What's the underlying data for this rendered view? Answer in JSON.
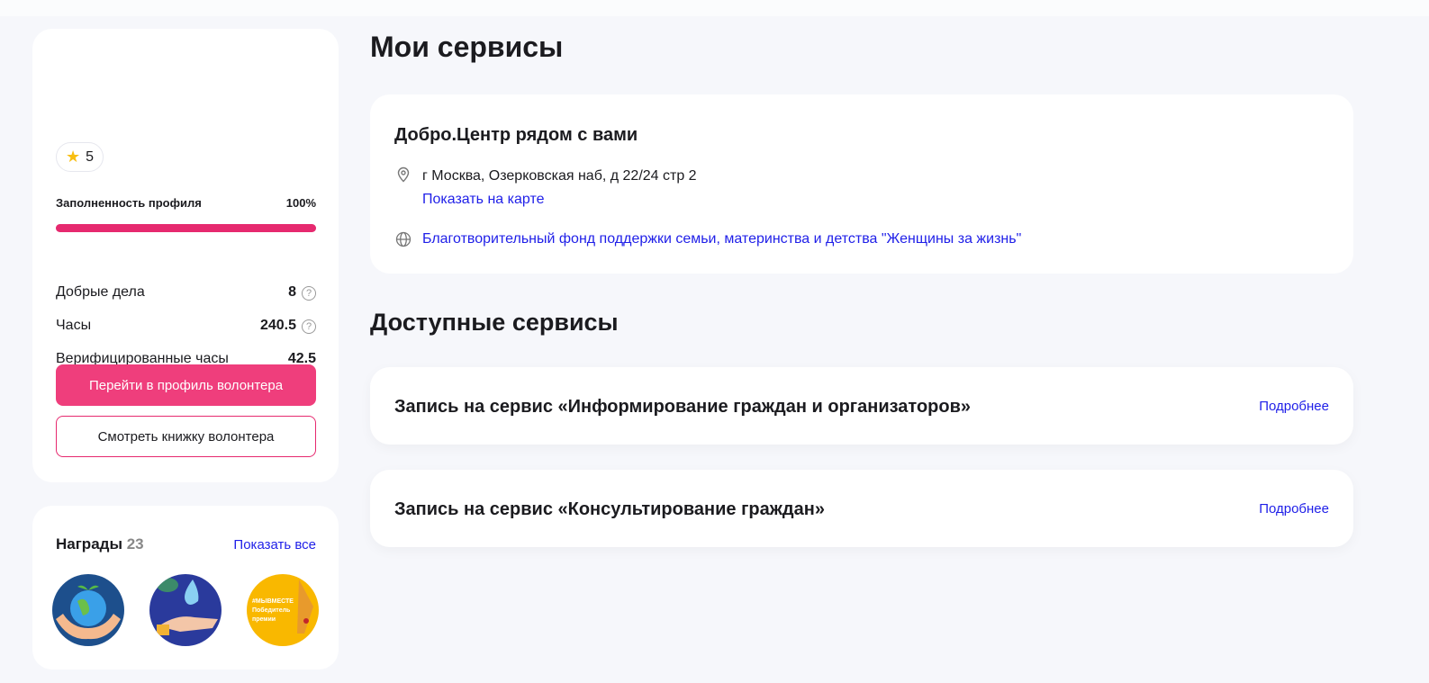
{
  "profile": {
    "rating": "5",
    "fill_label": "Заполненность профиля",
    "fill_value": "100%",
    "fill_percent": 100,
    "stats": [
      {
        "label": "Добрые дела",
        "value": "8",
        "help": true
      },
      {
        "label": "Часы",
        "value": "240.5",
        "help": true
      },
      {
        "label": "Верифицированные часы",
        "value": "42.5",
        "help": false
      }
    ],
    "primary_button": "Перейти в профиль волонтера",
    "secondary_button": "Смотреть книжку волонтера"
  },
  "awards": {
    "title": "Награды",
    "count": "23",
    "show_all": "Показать все",
    "badge3_text": "#МЫВМЕСТЕ Победитель премии"
  },
  "my_services": {
    "title": "Мои сервисы",
    "card": {
      "title": "Добро.Центр рядом с вами",
      "address": "г Москва, Озерковская наб, д 22/24 стр 2",
      "map_link": "Показать на карте",
      "org": "Благотворительный фонд поддержки семьи, материнства и детства \"Женщины за жизнь\""
    }
  },
  "available": {
    "title": "Доступные сервисы",
    "items": [
      {
        "title": "Запись на сервис «Информирование граждан и организаторов»",
        "link": "Подробнее"
      },
      {
        "title": "Запись на сервис «Консультирование граждан»",
        "link": "Подробнее"
      }
    ]
  },
  "colors": {
    "accent": "#ef3e7c",
    "link": "#1f1fe8"
  }
}
